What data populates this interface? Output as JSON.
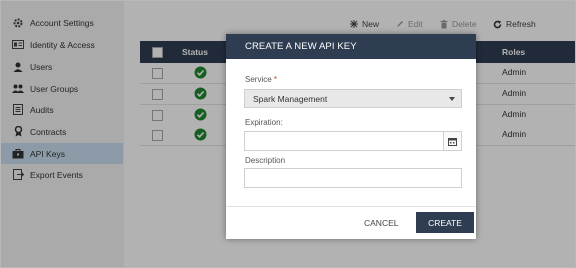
{
  "sidebar": {
    "items": [
      {
        "label": "Account Settings",
        "icon": "gear-icon"
      },
      {
        "label": "Identity & Access",
        "icon": "id-card-icon"
      },
      {
        "label": "Users",
        "icon": "user-icon"
      },
      {
        "label": "User Groups",
        "icon": "user-group-icon"
      },
      {
        "label": "Audits",
        "icon": "audit-icon"
      },
      {
        "label": "Contracts",
        "icon": "contract-icon"
      },
      {
        "label": "API Keys",
        "icon": "key-icon",
        "active": true
      },
      {
        "label": "Export Events",
        "icon": "export-icon"
      }
    ]
  },
  "toolbar": {
    "new_label": "New",
    "edit_label": "Edit",
    "delete_label": "Delete",
    "refresh_label": "Refresh"
  },
  "table": {
    "headers": {
      "status": "Status",
      "roles": "Roles"
    },
    "rows": [
      {
        "status": "active",
        "role": "Admin"
      },
      {
        "status": "active",
        "role": "Admin"
      },
      {
        "status": "active",
        "role": "Admin"
      },
      {
        "status": "active",
        "role": "Admin"
      }
    ]
  },
  "modal": {
    "title": "CREATE A NEW API KEY",
    "service_label": "Service",
    "service_required": "*",
    "service_value": "Spark Management",
    "expiration_label": "Expiration:",
    "expiration_value": "",
    "description_label": "Description",
    "description_value": "",
    "cancel_label": "CANCEL",
    "create_label": "CREATE"
  },
  "colors": {
    "header_bg": "#2f3d52",
    "active_nav": "#c9dff0",
    "status_ok": "#1f8a2e",
    "required": "#d9372a"
  }
}
